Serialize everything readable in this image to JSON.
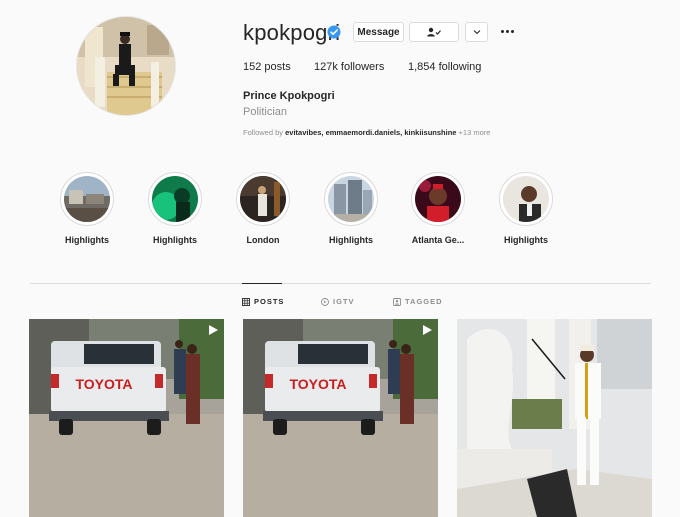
{
  "profile": {
    "username": "kpokpogri",
    "full_name": "Prince Kpokpogri",
    "category": "Politician",
    "followed_by_prefix": "Followed by",
    "followed_by_names": "evitavibes, emmaemordi.daniels, kinkiisunshine",
    "followed_by_more": "+13 more"
  },
  "buttons": {
    "message": "Message"
  },
  "stats": {
    "posts_count": "152",
    "posts_label": "posts",
    "followers_count": "127k",
    "followers_label": "followers",
    "following_count": "1,854",
    "following_label": "following"
  },
  "highlights": [
    {
      "label": "Highlights"
    },
    {
      "label": "Highlights"
    },
    {
      "label": "London"
    },
    {
      "label": "Highlights"
    },
    {
      "label": "Atlanta Ge..."
    },
    {
      "label": "Highlights"
    }
  ],
  "tabs": {
    "posts": "POSTS",
    "igtv": "IGTV",
    "tagged": "TAGGED"
  },
  "post_text": {
    "truck_brand": "TOYOTA"
  },
  "icons": {
    "verified": "verified-badge-icon",
    "follow_status": "person-check-icon",
    "dropdown": "chevron-down-icon",
    "more": "more-horizontal-icon",
    "posts_tab": "grid-icon",
    "igtv_tab": "igtv-icon",
    "tagged_tab": "tag-person-icon",
    "video": "video-play-icon"
  },
  "colors": {
    "background": "#fafafa",
    "verified_blue": "#3897f0",
    "text_primary": "#262626",
    "text_secondary": "#8e8e8e",
    "border": "#dbdbdb"
  }
}
